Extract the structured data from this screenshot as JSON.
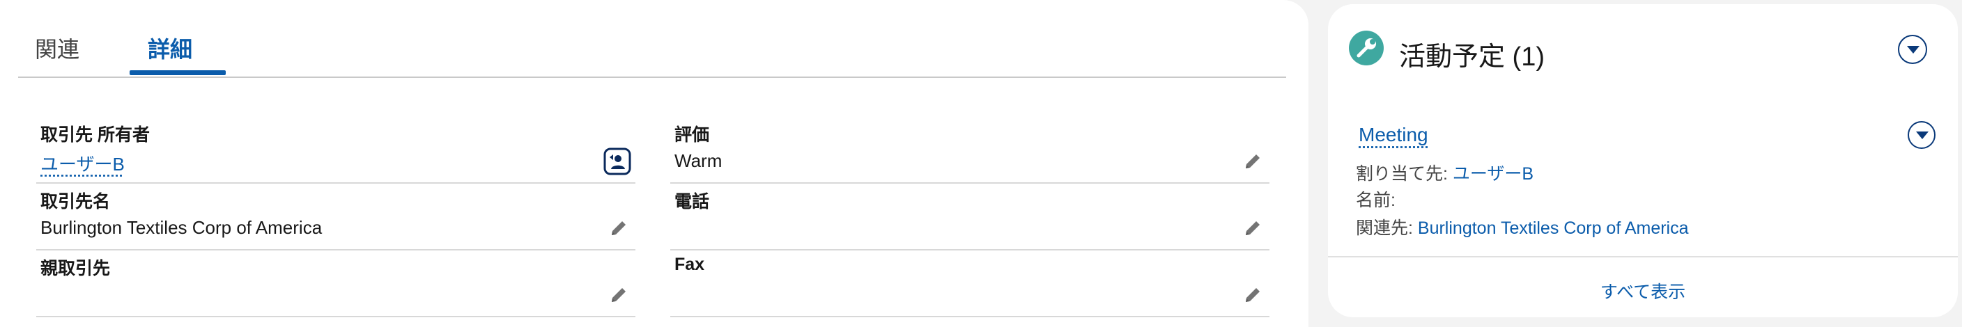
{
  "tabs": [
    {
      "label": "関連",
      "active": false
    },
    {
      "label": "詳細",
      "active": true
    }
  ],
  "fields": {
    "owner": {
      "label": "取引先 所有者",
      "value": "ユーザーB"
    },
    "rating": {
      "label": "評価",
      "value": "Warm"
    },
    "account_name": {
      "label": "取引先名",
      "value": "Burlington Textiles Corp of America"
    },
    "phone": {
      "label": "電話",
      "value": ""
    },
    "parent_account": {
      "label": "親取引先",
      "value": ""
    },
    "fax": {
      "label": "Fax",
      "value": ""
    }
  },
  "activity_panel": {
    "title": "活動予定 (1)",
    "item": {
      "title": "Meeting",
      "assigned_label": "割り当て先:",
      "assigned_value": "ユーザーB",
      "name_label": "名前:",
      "name_value": "",
      "related_label": "関連先:",
      "related_value": "Burlington Textiles Corp of America"
    },
    "view_all": "すべて表示"
  },
  "colors": {
    "accent": "#0b5cab",
    "icon_bg": "#3fa8a0",
    "background": "#f3f3f3"
  }
}
